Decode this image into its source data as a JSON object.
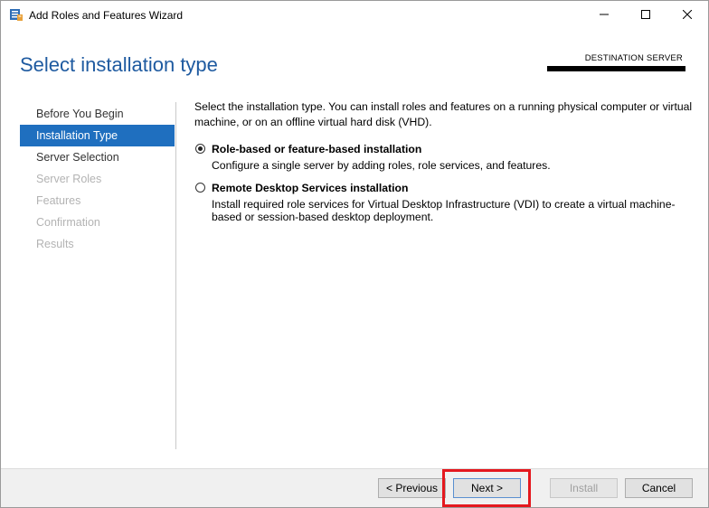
{
  "window": {
    "title": "Add Roles and Features Wizard",
    "controls": {
      "minimize_icon": "minimize-icon",
      "maximize_icon": "maximize-icon",
      "close_icon": "close-icon"
    }
  },
  "header": {
    "page_title": "Select installation type",
    "destination_label": "DESTINATION SERVER",
    "destination_value_redacted": true
  },
  "sidebar": {
    "items": [
      {
        "label": "Before You Begin",
        "state": "normal"
      },
      {
        "label": "Installation Type",
        "state": "active"
      },
      {
        "label": "Server Selection",
        "state": "normal"
      },
      {
        "label": "Server Roles",
        "state": "disabled"
      },
      {
        "label": "Features",
        "state": "disabled"
      },
      {
        "label": "Confirmation",
        "state": "disabled"
      },
      {
        "label": "Results",
        "state": "disabled"
      }
    ]
  },
  "main": {
    "intro": "Select the installation type. You can install roles and features on a running physical computer or virtual machine, or on an offline virtual hard disk (VHD).",
    "options": [
      {
        "label": "Role-based or feature-based installation",
        "description": "Configure a single server by adding roles, role services, and features.",
        "selected": true
      },
      {
        "label": "Remote Desktop Services installation",
        "description": "Install required role services for Virtual Desktop Infrastructure (VDI) to create a virtual machine-based or session-based desktop deployment.",
        "selected": false
      }
    ]
  },
  "footer": {
    "previous_label": "< Previous",
    "next_label": "Next >",
    "install_label": "Install",
    "cancel_label": "Cancel",
    "install_enabled": false,
    "highlight_color": "#e4181e"
  }
}
